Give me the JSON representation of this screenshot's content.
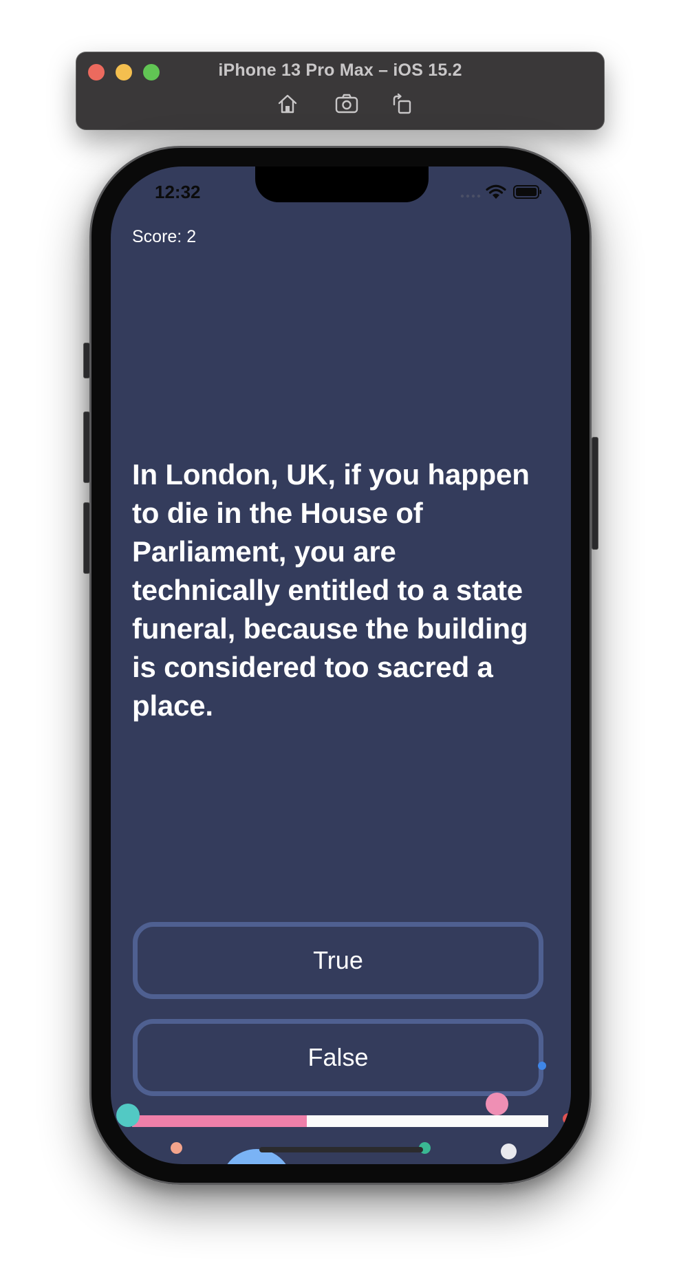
{
  "window": {
    "title": "iPhone 13 Pro Max – iOS 15.2",
    "toolbar": [
      {
        "icon": "home-icon"
      },
      {
        "icon": "screenshot-icon"
      },
      {
        "icon": "rotate-icon"
      }
    ]
  },
  "status_bar": {
    "time": "12:32"
  },
  "quiz": {
    "score_label": "Score: 2",
    "question": "In London, UK, if you happen to die in the House of Parliament, you are technically entitled to a state funeral, because the building is considered too sacred a place.",
    "true_label": "True",
    "false_label": "False",
    "progress_fraction": 0.42
  },
  "colors": {
    "screen_background": "#343c5c",
    "button_border": "#4f6091",
    "progress_fill": "#ee7fa9",
    "progress_track": "#fafafa"
  },
  "confetti": [
    {
      "color": "#52c9c4"
    },
    {
      "color": "#f3a48c"
    },
    {
      "color": "#7ab3f5"
    },
    {
      "color": "#3ab893"
    },
    {
      "color": "#e9e9ee"
    },
    {
      "color": "#ef8fb4"
    },
    {
      "color": "#3f86e8"
    },
    {
      "color": "#e05252"
    }
  ]
}
